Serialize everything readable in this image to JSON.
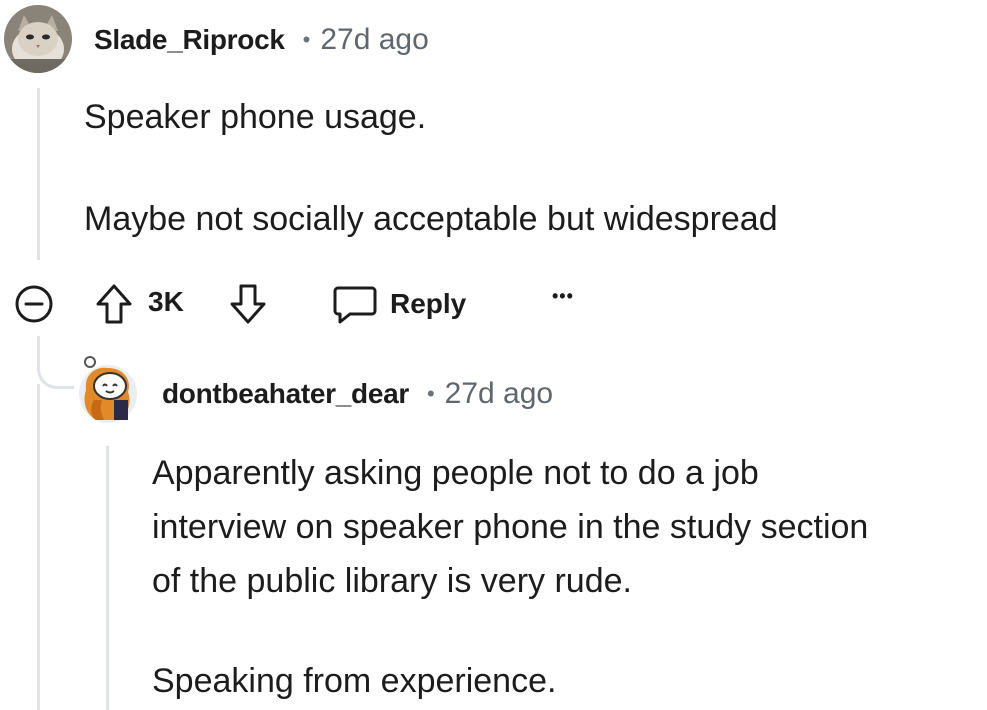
{
  "comment": {
    "author": "Slade_Riprock",
    "separator": "•",
    "time": "27d ago",
    "paragraphs": [
      "Speaker phone usage.",
      "Maybe not socially acceptable but widespread"
    ],
    "votes": "3K",
    "reply_label": "Reply",
    "more_label": "•••"
  },
  "reply": {
    "author": "dontbeahater_dear",
    "separator": "•",
    "time": "27d ago",
    "lines": [
      "Apparently asking people not to do a job",
      "interview on speaker phone in the study section",
      "of the public library is very rude."
    ],
    "last_paragraph": "Speaking from experience."
  },
  "icons": {
    "collapse": "collapse-minus-icon",
    "upvote": "upvote-arrow-icon",
    "downvote": "downvote-arrow-icon",
    "reply": "speech-bubble-icon",
    "more": "more-options-icon"
  }
}
